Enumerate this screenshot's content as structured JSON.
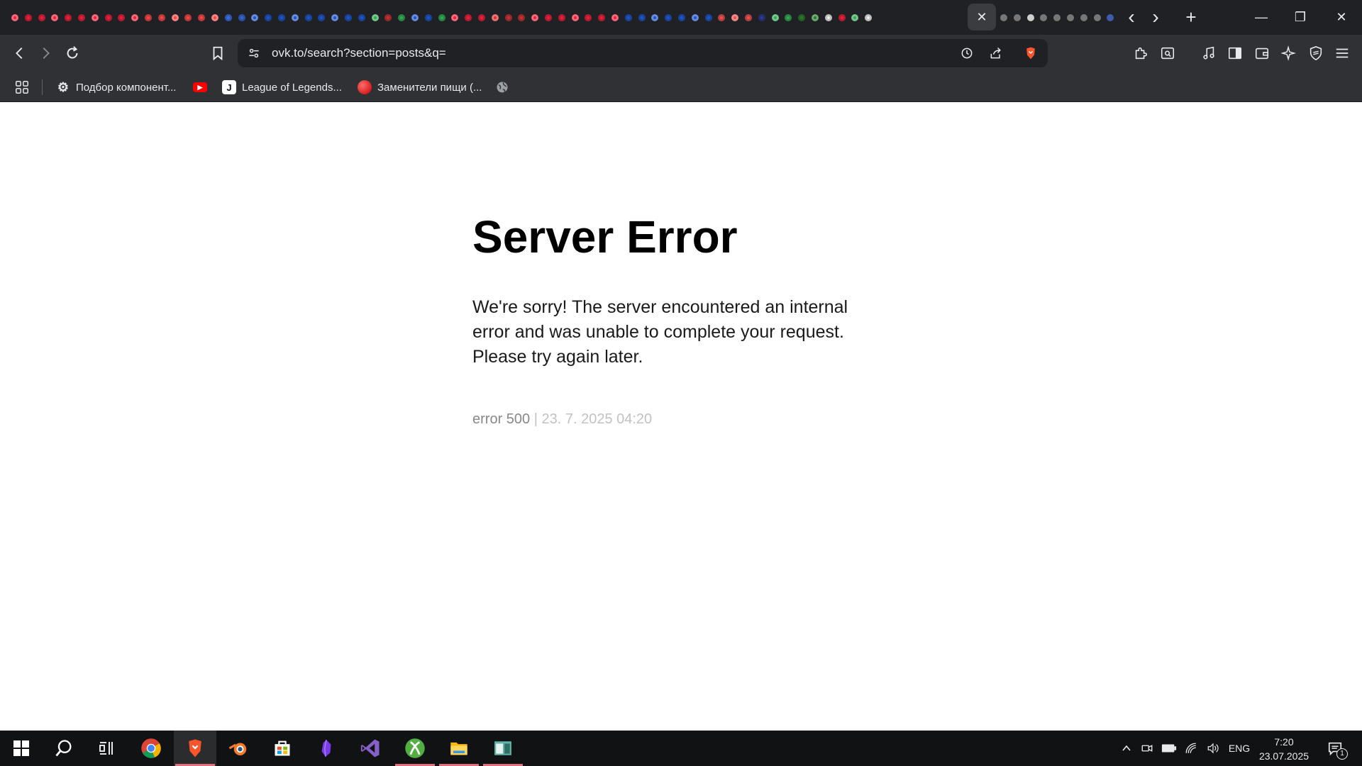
{
  "browser": {
    "active_tab_close": "✕",
    "window_controls": {
      "minimize": "—",
      "restore": "❐",
      "close": "✕"
    },
    "new_tab": "+",
    "address": "ovk.to/search?section=posts&q=",
    "colors": {
      "tabstrip": "#202124",
      "toolbar": "#303134",
      "brave_orange": "#fb542b"
    }
  },
  "bookmarks": [
    {
      "label": "Подбор компонент...",
      "icon": "gear-icon"
    },
    {
      "label": "",
      "icon": "youtube-icon"
    },
    {
      "label": "League of Legends...",
      "icon": "j-icon"
    },
    {
      "label": "Заменители пищи (...",
      "icon": "red-ball-icon"
    },
    {
      "label": "",
      "icon": "globe-icon"
    }
  ],
  "page": {
    "title": "Server Error",
    "message": "We're sorry! The server encountered an internal error and was unable to complete your request. Please try again later.",
    "error_code": "error 500",
    "separator": "|",
    "timestamp": "23. 7. 2025 04:20"
  },
  "taskbar": {
    "apps": [
      "start-icon",
      "search-icon",
      "task-view-icon",
      "chrome-icon",
      "brave-icon",
      "blender-icon",
      "store-icon",
      "obsidian-icon",
      "visual-studio-icon",
      "xbox-icon",
      "file-explorer-icon",
      "app-icon"
    ],
    "language": "ENG",
    "time": "7:20",
    "date": "23.07.2025",
    "notification_count": "1"
  }
}
